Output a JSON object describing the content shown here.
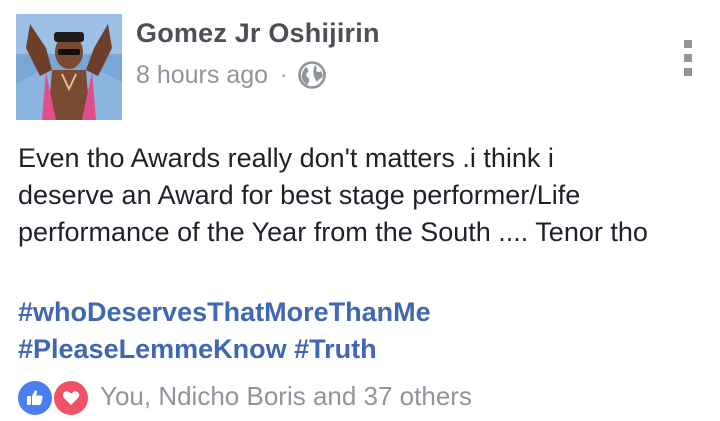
{
  "post": {
    "author": "Gomez Jr Oshijirin",
    "timestamp": "8 hours ago",
    "separator": "·",
    "privacy_icon": "globe-icon",
    "menu_icon": "vertical-ellipsis-icon",
    "body_lines": [
      "Even tho Awards really don't matters .i think i",
      "deserve an Award for  best stage performer/Life",
      "performance of the Year from the South .... Tenor tho"
    ],
    "hashtags": [
      "#whoDeservesThatMoreThanMe",
      "#PleaseLemmeKnow",
      "#Truth"
    ],
    "reactions": {
      "icons": [
        "like-icon",
        "love-icon"
      ],
      "summary": "You, Ndicho Boris and 37 others"
    }
  },
  "colors": {
    "link": "#4267b2",
    "secondary_text": "#90949c",
    "author_name": "#4b4f56",
    "like_blue": "#4a7ff0",
    "love_red": "#f25268"
  }
}
